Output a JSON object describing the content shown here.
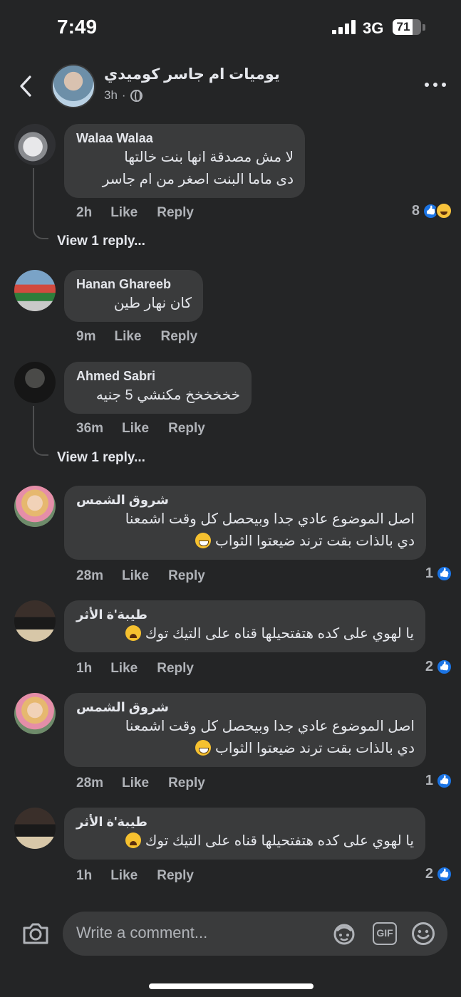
{
  "status_bar": {
    "time": "7:49",
    "network": "3G",
    "battery": "71",
    "battery_level": 0.71
  },
  "header": {
    "page_name": "يوميات ام جاسر كوميدي",
    "time": "3h",
    "dot": "·"
  },
  "comments": [
    {
      "name": "Walaa Walaa",
      "lines": [
        "لا مش مصدقة انها بنت خالتها",
        "دى ماما البنت اصغر من ام جاسر"
      ],
      "time": "2h",
      "like": "Like",
      "reply": "Reply",
      "reactions": "8",
      "view_replies": "View 1 reply..."
    },
    {
      "name": "Hanan Ghareeb",
      "lines": [
        "كان نهار طين"
      ],
      "time": "9m",
      "like": "Like",
      "reply": "Reply"
    },
    {
      "name": "Ahmed Sabri",
      "lines": [
        "خخخخخخ مكنشي 5 جنيه"
      ],
      "time": "36m",
      "like": "Like",
      "reply": "Reply",
      "view_replies": "View 1 reply..."
    },
    {
      "name": "شروق الشمس",
      "lines": [
        "اصل الموضوع عادي جدا وبيحصل كل وقت اشمعنا",
        "دي بالذات بقت ترند ضيعتوا الثواب"
      ],
      "time": "28m",
      "like": "Like",
      "reply": "Reply",
      "reactions": "1"
    },
    {
      "name": "طيبة'ة الأثر",
      "lines": [
        "يا لهوي على كده هتفتحيلها قناه على التيك توك"
      ],
      "time": "1h",
      "like": "Like",
      "reply": "Reply",
      "reactions": "2"
    },
    {
      "name": "شروق الشمس",
      "lines": [
        "اصل الموضوع عادي جدا وبيحصل كل وقت اشمعنا",
        "دي بالذات بقت ترند ضيعتوا الثواب"
      ],
      "time": "28m",
      "like": "Like",
      "reply": "Reply",
      "reactions": "1"
    },
    {
      "name": "طيبة'ة الأثر",
      "lines": [
        "يا لهوي على كده هتفتحيلها قناه على التيك توك"
      ],
      "time": "1h",
      "like": "Like",
      "reply": "Reply",
      "reactions": "2"
    }
  ],
  "composer": {
    "placeholder": "Write a comment...",
    "gif_label": "GIF"
  },
  "icons": [
    "back-icon",
    "globe-icon",
    "more-icon",
    "like-reaction-icon",
    "haha-reaction-icon",
    "camera-icon",
    "avatar-sticker-icon",
    "gif-icon",
    "emoji-icon"
  ],
  "colors": {
    "background": "#242526",
    "bubble": "#3a3b3c",
    "like_blue": "#1b74e4",
    "text": "#e4e6eb",
    "muted": "#b0b3b8"
  }
}
